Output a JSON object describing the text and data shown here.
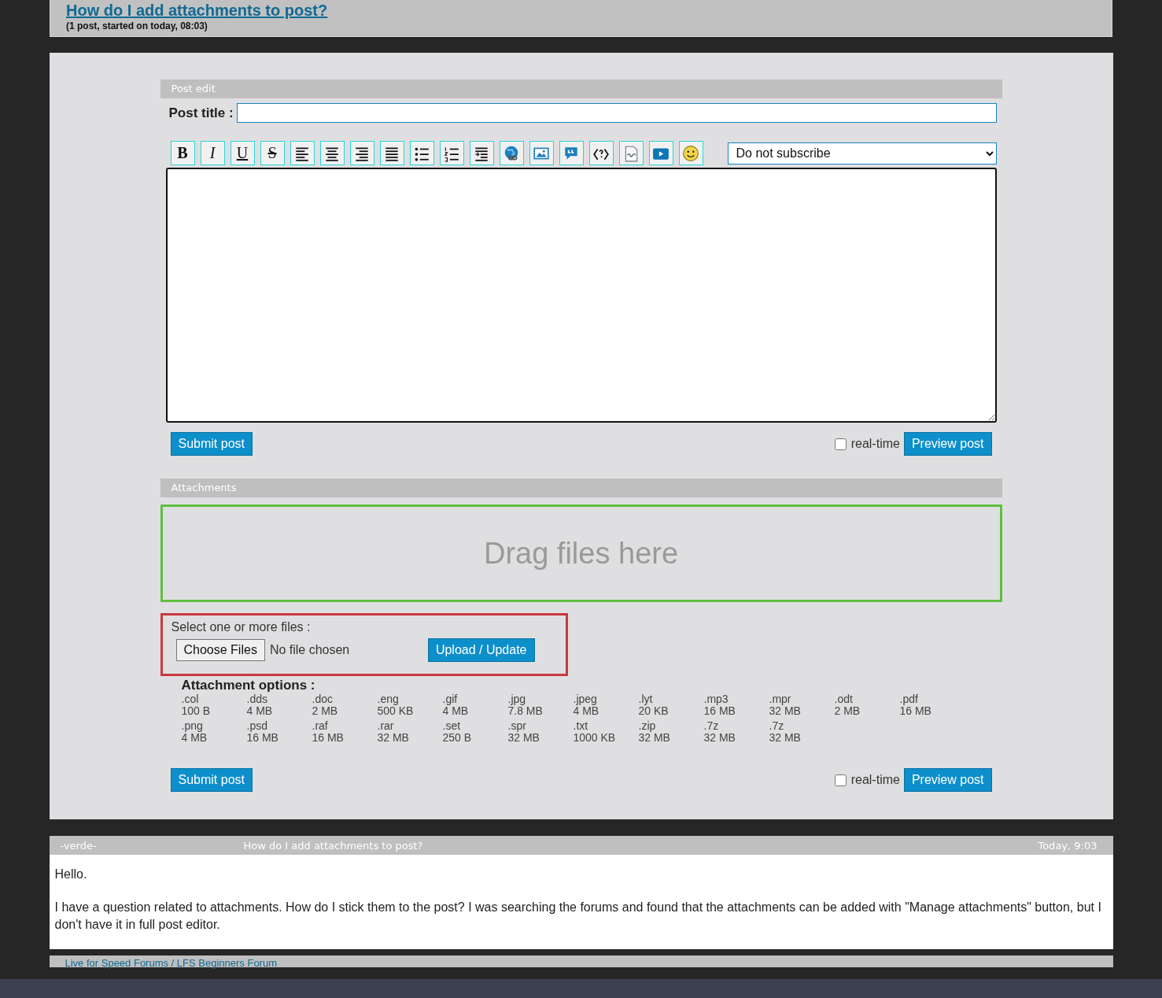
{
  "topic": {
    "title": "How do I add attachments to post?",
    "subtitle": "(1 post, started on today, 08:03)"
  },
  "post_edit": {
    "header": "Post edit",
    "title_label": "Post title :",
    "toolbar": [
      {
        "kind": "bold",
        "label": "B"
      },
      {
        "kind": "italic",
        "label": "I"
      },
      {
        "kind": "underline",
        "label": "U"
      },
      {
        "kind": "strike",
        "label": "S"
      },
      {
        "kind": "align-left"
      },
      {
        "kind": "align-center"
      },
      {
        "kind": "align-right"
      },
      {
        "kind": "justify"
      },
      {
        "kind": "bullets"
      },
      {
        "kind": "numbers"
      },
      {
        "kind": "indent"
      },
      {
        "kind": "link"
      },
      {
        "kind": "image"
      },
      {
        "kind": "quote"
      },
      {
        "kind": "code"
      },
      {
        "kind": "php"
      },
      {
        "kind": "video"
      },
      {
        "kind": "smiley"
      }
    ],
    "subscribe": "Do not subscribe",
    "submit": "Submit post",
    "realtime": {
      "label": "real-time",
      "checked": false
    },
    "preview": "Preview post"
  },
  "attachments": {
    "header": "Attachments",
    "dropzone": "Drag files here",
    "select_label": "Select one or more files :",
    "choose": "Choose Files",
    "no_file": "No file chosen",
    "upload": "Upload / Update",
    "options_title": "Attachment options :",
    "options": [
      {
        "ext": ".col",
        "size": "100 B"
      },
      {
        "ext": ".dds",
        "size": "4 MB"
      },
      {
        "ext": ".doc",
        "size": "2 MB"
      },
      {
        "ext": ".eng",
        "size": "500 KB"
      },
      {
        "ext": ".gif",
        "size": "4 MB"
      },
      {
        "ext": ".jpg",
        "size": "7.8 MB"
      },
      {
        "ext": ".jpeg",
        "size": "4 MB"
      },
      {
        "ext": ".lyt",
        "size": "20 KB"
      },
      {
        "ext": ".mp3",
        "size": "16 MB"
      },
      {
        "ext": ".mpr",
        "size": "32 MB"
      },
      {
        "ext": ".odt",
        "size": "2 MB"
      },
      {
        "ext": ".pdf",
        "size": "16 MB"
      },
      {
        "ext": ".png",
        "size": "4 MB"
      },
      {
        "ext": ".psd",
        "size": "16 MB"
      },
      {
        "ext": ".raf",
        "size": "16 MB"
      },
      {
        "ext": ".rar",
        "size": "32 MB"
      },
      {
        "ext": ".set",
        "size": "250 B"
      },
      {
        "ext": ".spr",
        "size": "32 MB"
      },
      {
        "ext": ".txt",
        "size": "1000 KB"
      },
      {
        "ext": ".zip",
        "size": "32 MB"
      },
      {
        "ext": ".7z",
        "size": "32 MB"
      },
      {
        "ext": ".7z",
        "size": "32 MB"
      }
    ],
    "submit": "Submit post",
    "realtime": {
      "label": "real-time",
      "checked": false
    },
    "preview": "Preview post"
  },
  "post": {
    "author": "-verde-",
    "subject": "How do I add attachments to post?",
    "time": "Today, 9:03",
    "paragraphs": [
      "Hello.",
      "I have a question related to attachments. How do I stick them to the post? I was searching the forums and found that the attachments can be added with \"Manage attachments\" button, but I don't have it in full post editor."
    ]
  },
  "breadcrumb": "Live for Speed Forums / LFS Beginners Forum"
}
